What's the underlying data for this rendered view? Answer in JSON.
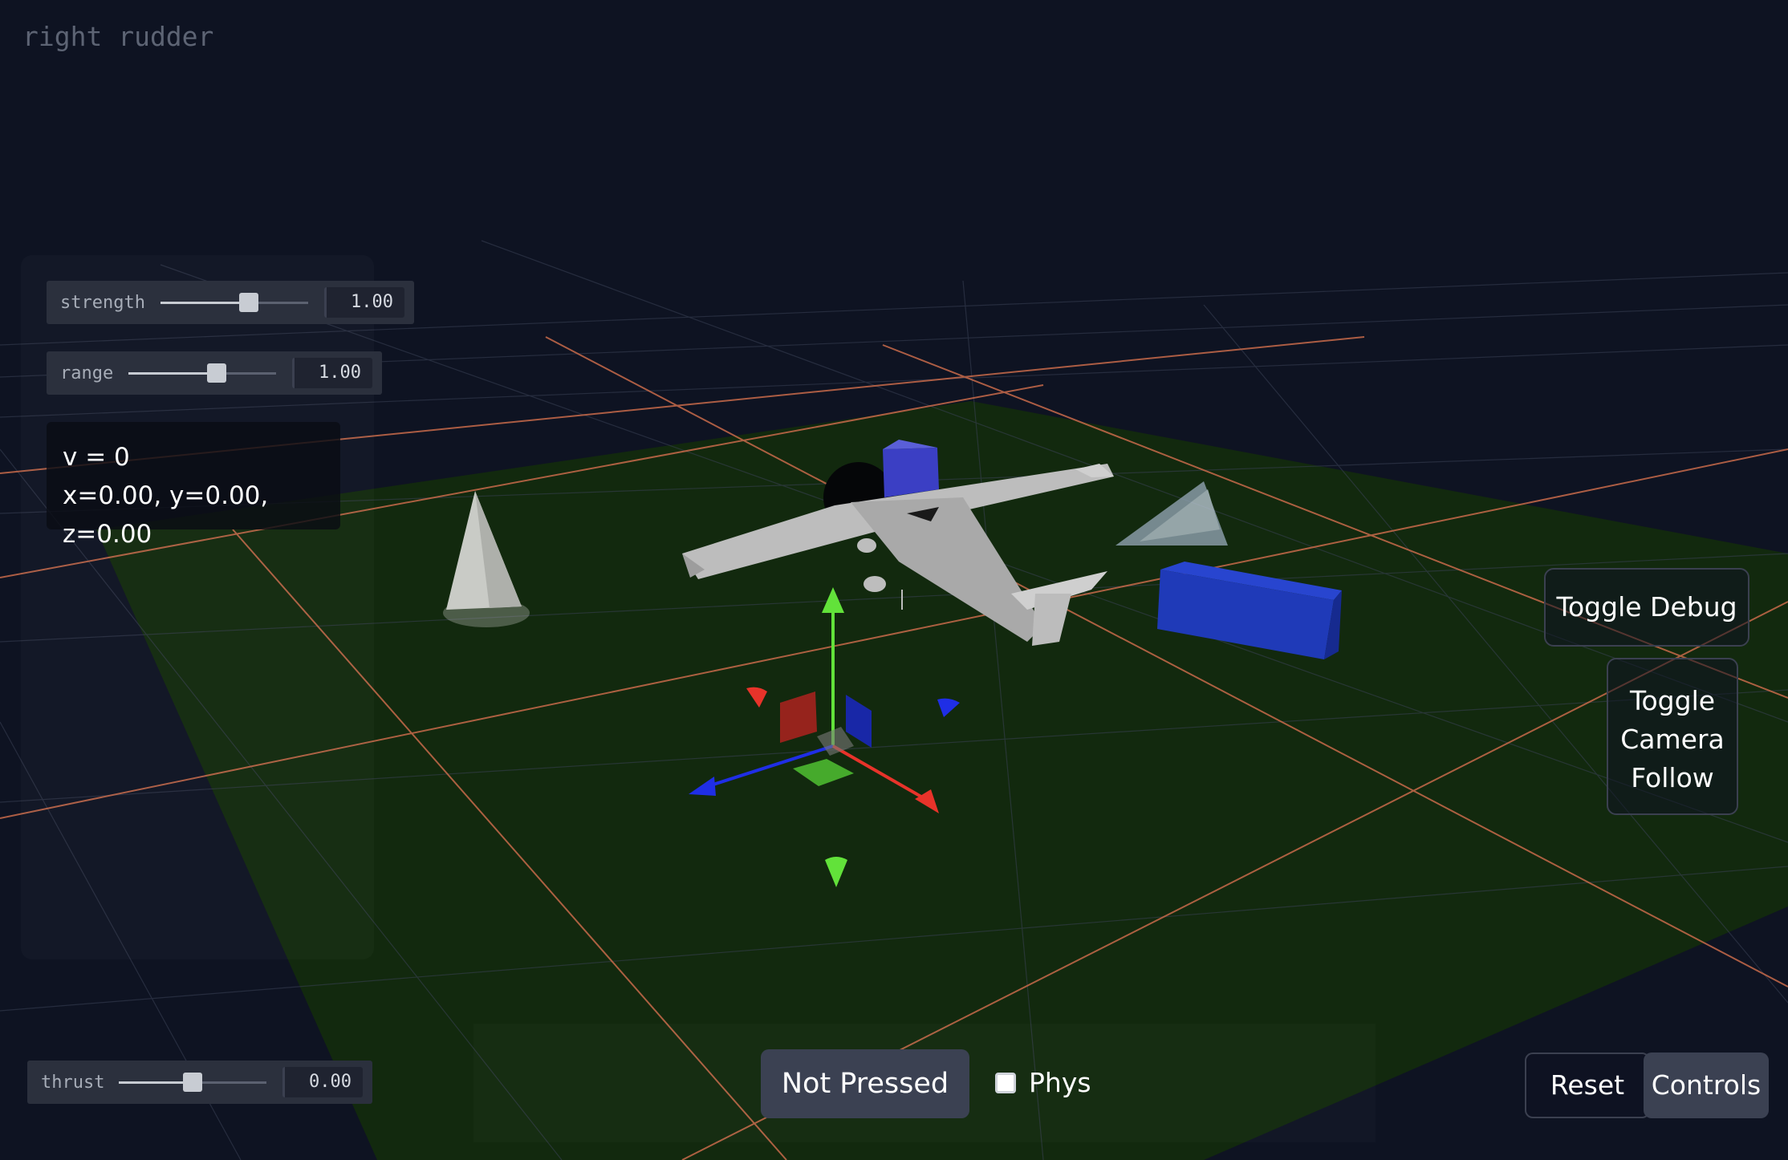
{
  "status": {
    "text": "right rudder"
  },
  "sliders": [
    {
      "label": "strength",
      "value": "1.00",
      "fraction": 0.6
    },
    {
      "label": "range",
      "value": "1.00",
      "fraction": 0.6
    },
    {
      "label": "thrust",
      "value": "0.00",
      "fraction": 0.5
    }
  ],
  "readout": {
    "velocity": "v = 0",
    "position": "x=0.00, y=0.00, z=0.00"
  },
  "buttons": {
    "toggle_debug": "Toggle Debug",
    "toggle_camera_line1": "Toggle",
    "toggle_camera_line2": "Camera",
    "toggle_camera_line3": "Follow",
    "not_pressed": "Not Pressed",
    "reset": "Reset",
    "controls": "Controls"
  },
  "phys": {
    "label": "Phys",
    "checked": false
  },
  "colors": {
    "background": "#0e1322",
    "ground": "#132a0e",
    "grid_major": "#c86a4a",
    "axis_x": "#e8332a",
    "axis_y": "#62e23a",
    "axis_z": "#1f2ee6",
    "box_blue": "#1f3ab8"
  }
}
